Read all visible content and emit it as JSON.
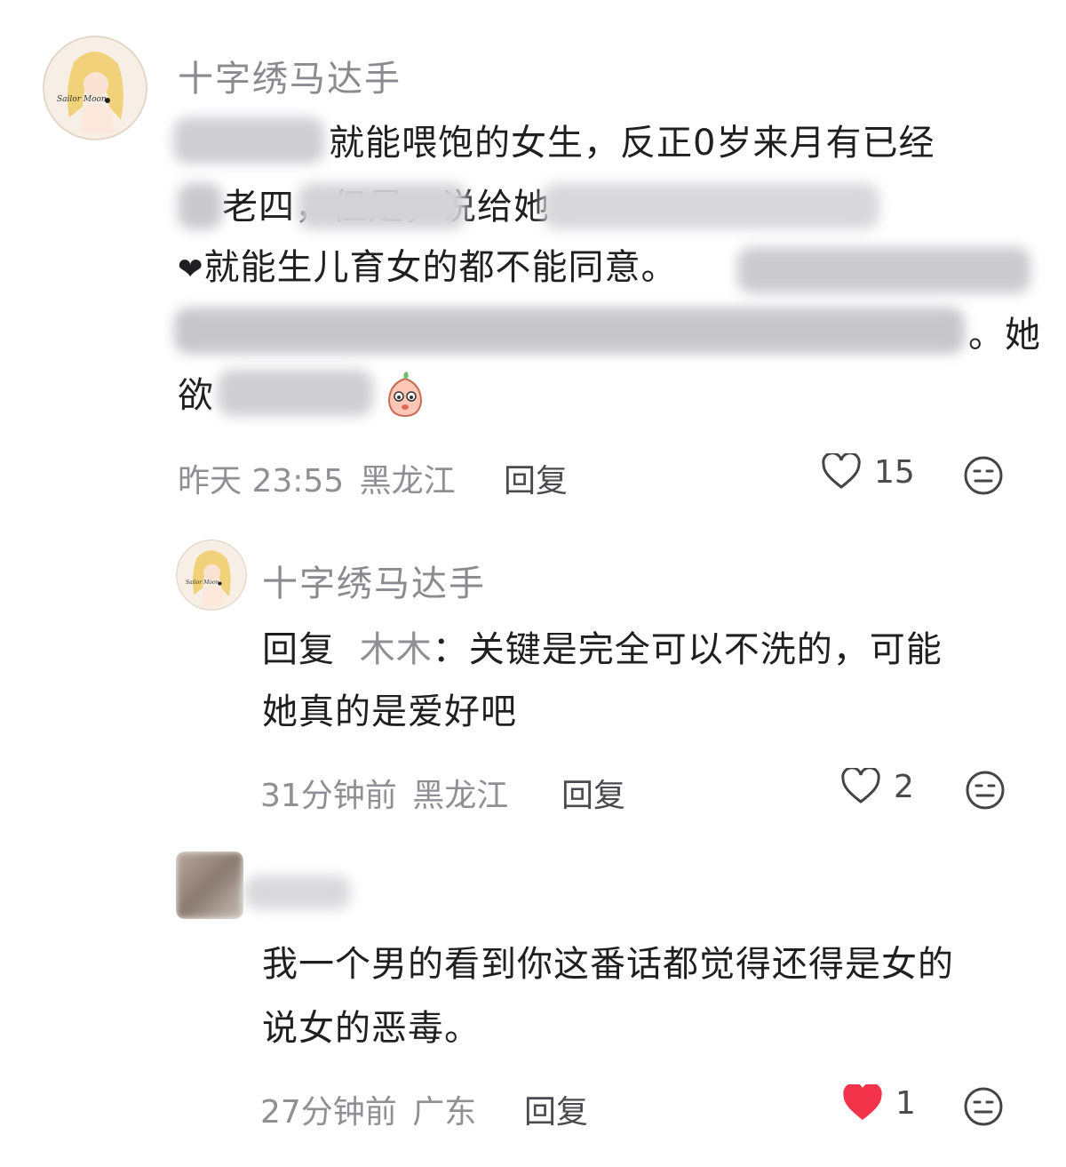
{
  "comments": [
    {
      "username": "十字绣马达手",
      "text_lines": [
        "就能喂饱的女生，反正0岁来月有已经",
        "老四，但是，说给她",
        "就能生儿育女的都不能同意。",
        "。她",
        "欲"
      ],
      "time": "昨天 23:55",
      "location": "黑龙江",
      "reply_label": "回复",
      "likes": "15",
      "liked": false
    },
    {
      "username": "十字绣马达手",
      "reply_prefix": "回复",
      "reply_to": "木木",
      "text_line1": "：关键是完全可以不洗的，可能",
      "text_line2": "她真的是爱好吧",
      "time": "31分钟前",
      "location": "黑龙江",
      "reply_label": "回复",
      "likes": "2",
      "liked": false
    },
    {
      "text_line1": "我一个男的看到你这番话都觉得还得是女的",
      "text_line2": "说女的恶毒。",
      "time": "27分钟前",
      "location": "广东",
      "reply_label": "回复",
      "likes": "1",
      "liked": true
    }
  ],
  "colors": {
    "like_active": "#f2334a",
    "meta_gray": "#8f8f94"
  }
}
